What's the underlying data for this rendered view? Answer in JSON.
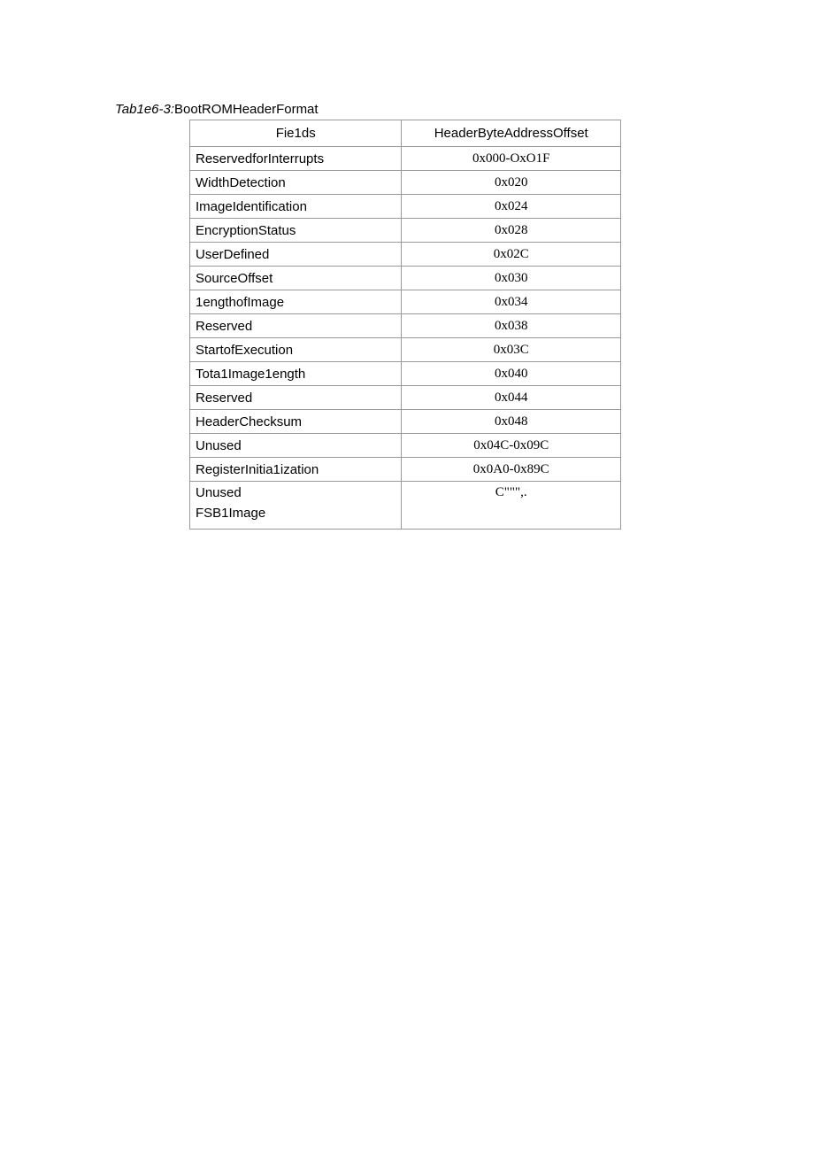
{
  "caption": {
    "label": "Tab1e6-3:",
    "title": "BootROMHeaderFormat"
  },
  "table": {
    "headers": [
      "Fie1ds",
      "HeaderByteAddressOffset"
    ],
    "rows": [
      {
        "field": "ReservedforInterrupts",
        "offset": "0x000-OxO1F"
      },
      {
        "field": "WidthDetection",
        "offset": "0x020"
      },
      {
        "field": "ImageIdentification",
        "offset": "0x024"
      },
      {
        "field": "EncryptionStatus",
        "offset": "0x028"
      },
      {
        "field": "UserDefined",
        "offset": "0x02C"
      },
      {
        "field": "SourceOffset",
        "offset": "0x030"
      },
      {
        "field": "1engthofImage",
        "offset": "0x034"
      },
      {
        "field": "Reserved",
        "offset": "0x038"
      },
      {
        "field": "StartofExecution",
        "offset": "0x03C"
      },
      {
        "field": "Tota1Image1ength",
        "offset": "0x040"
      },
      {
        "field": "Reserved",
        "offset": "0x044"
      },
      {
        "field": "HeaderChecksum",
        "offset": "0x048"
      },
      {
        "field": "Unused",
        "offset": "0x04C-0x09C"
      },
      {
        "field": "RegisterInitia1ization",
        "offset": "0x0A0-0x89C"
      }
    ],
    "lastRow": {
      "field1": "Unused",
      "field2": "FSB1Image",
      "offset": "C\"\"\",."
    }
  }
}
